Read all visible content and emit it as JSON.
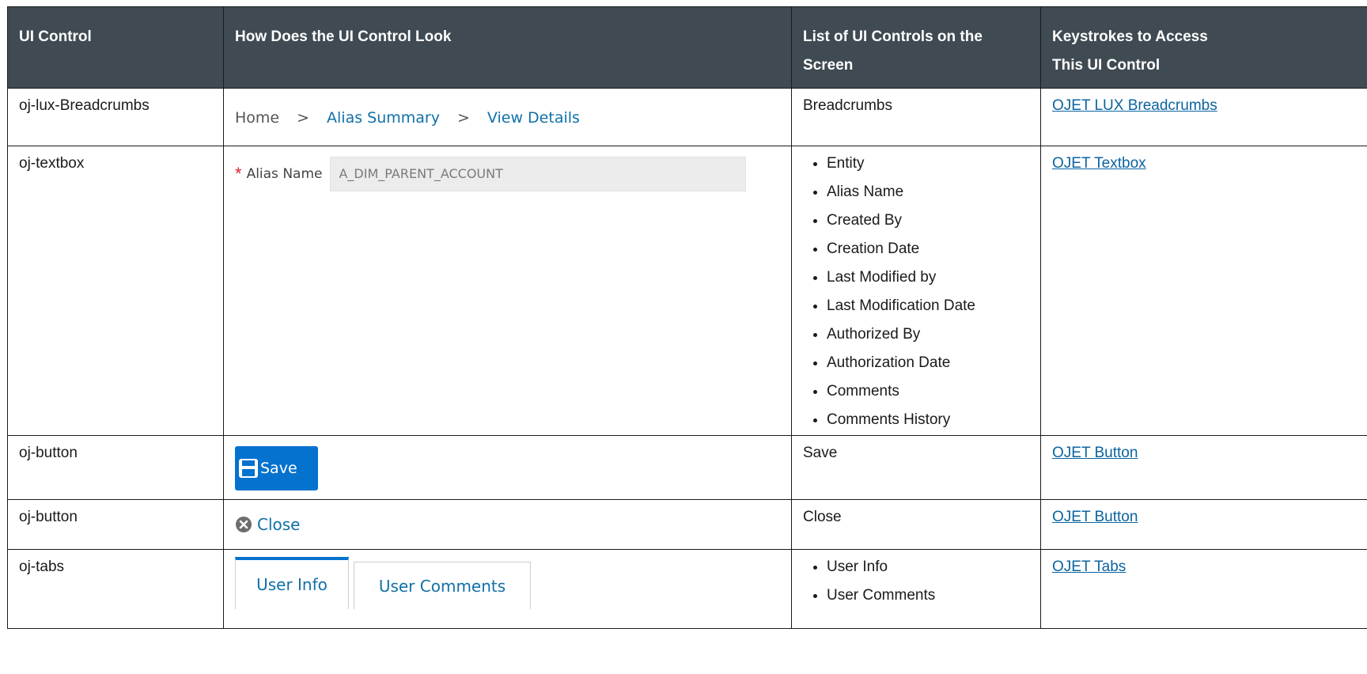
{
  "headers": {
    "col1": "UI Control",
    "col2": "How Does the UI Control Look",
    "col3_line1": "List of UI Controls on the",
    "col3_line2": "Screen",
    "col4_line1": "Keystrokes to Access",
    "col4_line2": "This UI Control"
  },
  "rows": [
    {
      "control": "oj-lux-Breadcrumbs",
      "preview": {
        "home": "Home",
        "sep": ">",
        "crumb2": "Alias Summary",
        "crumb3": "View Details"
      },
      "list": "Breadcrumbs",
      "link": "OJET LUX Breadcrumbs"
    },
    {
      "control": "oj-textbox",
      "preview": {
        "required": "*",
        "label": "Alias Name",
        "value": "A_DIM_PARENT_ACCOUNT"
      },
      "list": [
        "Entity",
        "Alias Name",
        "Created By",
        "Creation Date",
        "Last Modified by",
        "Last Modification Date",
        "Authorized By",
        "Authorization Date",
        "Comments",
        "Comments History"
      ],
      "link": "OJET Textbox"
    },
    {
      "control": "oj-button",
      "preview": {
        "label": "Save",
        "icon": "save-disk-icon"
      },
      "list": "Save",
      "link": "OJET Button"
    },
    {
      "control": "oj-button",
      "preview": {
        "label": "Close",
        "icon": "close-circle-icon"
      },
      "list": "Close",
      "link": "OJET Button"
    },
    {
      "control": "oj-tabs",
      "preview": {
        "tab1": "User Info",
        "tab2": "User Comments"
      },
      "list": [
        "User Info",
        "User Comments"
      ],
      "link": "OJET Tabs"
    }
  ],
  "colors": {
    "header_bg": "#3f4a52",
    "link": "#0b64a0",
    "accent": "#0572ce"
  }
}
